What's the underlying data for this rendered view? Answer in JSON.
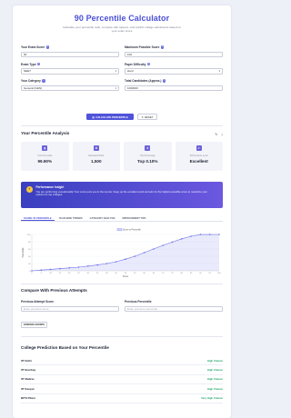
{
  "header": {
    "title": "90 Percentile Calculator",
    "subtitle": "Calculate your percentile rank, compare with toppers, and predict college admissions based on your exam score"
  },
  "form": {
    "exam_score_label": "Your Exam Score",
    "exam_score_value": "90",
    "max_score_label": "Maximum Possible Score",
    "max_score_value": "100",
    "exam_type_label": "Exam Type",
    "exam_type_value": "NEET",
    "difficulty_label": "Paper Difficulty",
    "difficulty_value": "Hard",
    "category_label": "Your Category",
    "category_value": "General (GEN)",
    "candidates_label": "Total Candidates (Approx.)",
    "candidates_value": "1000000"
  },
  "actions": {
    "calculate_label": "CALCULATE PERCENTILE",
    "reset_label": "RESET"
  },
  "analysis": {
    "title": "Your Percentile Analysis",
    "stats": [
      {
        "icon": "chart-icon",
        "glyph": "▮",
        "label": "Your Percentile",
        "value": "99.90%"
      },
      {
        "icon": "trophy-icon",
        "glyph": "♛",
        "label": "Estimated Rank",
        "value": "1,500"
      },
      {
        "icon": "star-icon",
        "glyph": "★",
        "label": "Top Percentage",
        "value": "Top 0.10%"
      },
      {
        "icon": "badge-icon",
        "glyph": "✔",
        "label": "Performance Level",
        "value": "Excellent"
      }
    ],
    "insight_title": "Performance Insight",
    "insight_text": "You are performing exceptionally! Your score puts you in the top tier. Keep up the excellent work and aim for the highest possible score to maximize your options for top colleges."
  },
  "tabs": [
    "SCORE VS PERCENTILE",
    "YEAR-WISE TRENDS",
    "CATEGORY ANALYSIS",
    "IMPROVEMENT TIPS"
  ],
  "chart_data": {
    "type": "area",
    "legend": "Score vs Percentile",
    "xlabel": "Score",
    "ylabel": "Percentile",
    "x": [
      0,
      5,
      10,
      15,
      20,
      25,
      30,
      35,
      40,
      45,
      50,
      55,
      60,
      65,
      70,
      75,
      80,
      85,
      90,
      95,
      100
    ],
    "y": [
      0,
      2,
      4,
      6,
      8,
      10,
      13,
      16,
      20,
      25,
      32,
      40,
      50,
      60,
      70,
      79,
      88,
      95,
      99.9,
      99.9,
      100
    ],
    "ylim": [
      0,
      100
    ],
    "yticks": [
      0,
      20,
      40,
      60,
      80,
      100
    ],
    "color": "#6b70e6"
  },
  "compare": {
    "title": "Compare With Previous Attempts",
    "prev_score_label": "Previous Attempt Score",
    "prev_score_placeholder": "Enter previous score",
    "prev_percentile_label": "Previous Percentile",
    "prev_percentile_placeholder": "Enter previous percentile",
    "button_label": "COMPARE GROWTH"
  },
  "colleges": {
    "title": "College Prediction Based on Your Percentile",
    "items": [
      {
        "name": "IIT Delhi",
        "chance": "High Chance"
      },
      {
        "name": "IIT Bombay",
        "chance": "High Chance"
      },
      {
        "name": "IIT Madras",
        "chance": "High Chance"
      },
      {
        "name": "IIT Kanpur",
        "chance": "High Chance"
      },
      {
        "name": "BITS Pilani",
        "chance": "Very High Chance"
      }
    ]
  }
}
